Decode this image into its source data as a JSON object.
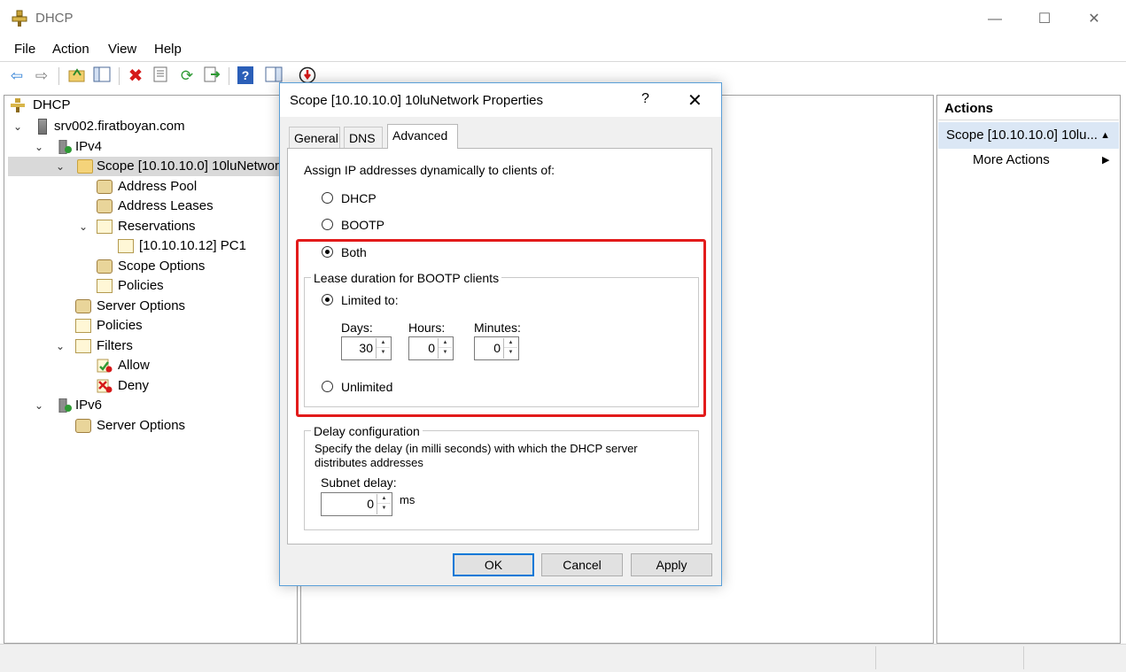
{
  "window": {
    "title": "DHCP",
    "controls": {
      "minimize": "—",
      "maximize": "☐",
      "close": "✕"
    }
  },
  "menu": [
    "File",
    "Action",
    "View",
    "Help"
  ],
  "toolbar": {
    "icons": [
      "back-icon",
      "forward-icon",
      "up-folder-icon",
      "show-hide-tree-icon",
      "delete-icon",
      "properties-icon",
      "refresh-icon",
      "export-list-icon",
      "help-icon",
      "show-hide-action-pane-icon",
      "add-scope-icon"
    ],
    "glyphs": {
      "back": "⇦",
      "forward": "⇨",
      "help": "?",
      "delete": "✖",
      "refresh": "⟳",
      "down": "⬇"
    },
    "accent": "#3c7fcf"
  },
  "tree": {
    "root": "DHCP",
    "server": "srv002.firatboyan.com",
    "ipv4": "IPv4",
    "scope": "Scope [10.10.10.0] 10luNetwork",
    "address_pool": "Address Pool",
    "address_leases": "Address Leases",
    "reservations": "Reservations",
    "reservation_pc1": "[10.10.10.12] PC1",
    "scope_options": "Scope Options",
    "scope_policies": "Policies",
    "server_options": "Server Options",
    "policies": "Policies",
    "filters": "Filters",
    "allow": "Allow",
    "deny": "Deny",
    "ipv6": "IPv6",
    "ipv6_server_options": "Server Options"
  },
  "actions": {
    "header": "Actions",
    "scope_item": "Scope [10.10.10.0] 10lu...",
    "collapse_glyph": "▲",
    "more_actions": "More Actions",
    "more_glyph": "▶"
  },
  "dialog": {
    "title": "Scope [10.10.10.0] 10luNetwork Properties",
    "help_glyph": "?",
    "close_glyph": "✕",
    "tabs": [
      "General",
      "DNS",
      "Advanced"
    ],
    "active_tab": "Advanced",
    "assign_label": "Assign IP addresses dynamically to clients of:",
    "options": {
      "dhcp": "DHCP",
      "bootp": "BOOTP",
      "both": "Both"
    },
    "selected_option": "Both",
    "lease_group": {
      "title": "Lease duration for BOOTP clients",
      "limited": "Limited to:",
      "unlimited": "Unlimited",
      "selected": "Limited to:",
      "days_label": "Days:",
      "hours_label": "Hours:",
      "minutes_label": "Minutes:",
      "days": "30",
      "hours": "0",
      "minutes": "0"
    },
    "delay_group": {
      "title": "Delay configuration",
      "desc1": "Specify the delay (in milli seconds) with which the DHCP server",
      "desc2": "distributes addresses",
      "subnet_label": "Subnet delay:",
      "subnet_value": "0",
      "unit": "ms"
    },
    "buttons": {
      "ok": "OK",
      "cancel": "Cancel",
      "apply": "Apply"
    },
    "highlight_color": "#e21b1b"
  }
}
